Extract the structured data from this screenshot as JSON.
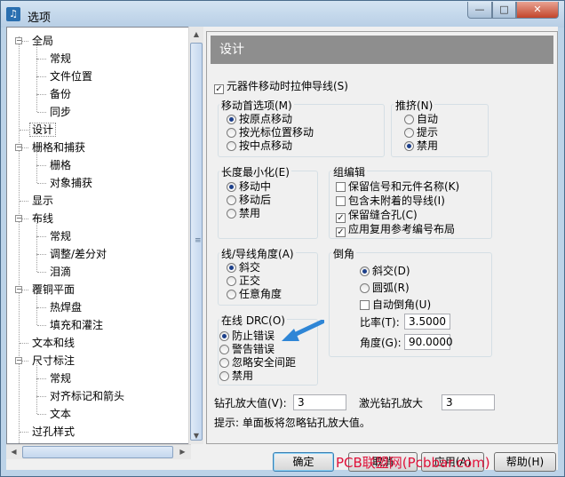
{
  "window": {
    "title": "选项",
    "app_icon": "pads-app-icon",
    "controls": {
      "minimize": "—",
      "maximize": "□",
      "close": "✕"
    }
  },
  "tree": {
    "items": [
      {
        "label": "全局",
        "level": 0,
        "expander": "−"
      },
      {
        "label": "常规",
        "level": 1
      },
      {
        "label": "文件位置",
        "level": 1
      },
      {
        "label": "备份",
        "level": 1
      },
      {
        "label": "同步",
        "level": 1
      },
      {
        "label": "设计",
        "level": 0,
        "selected": true
      },
      {
        "label": "栅格和捕获",
        "level": 0,
        "expander": "−"
      },
      {
        "label": "栅格",
        "level": 1
      },
      {
        "label": "对象捕获",
        "level": 1
      },
      {
        "label": "显示",
        "level": 0
      },
      {
        "label": "布线",
        "level": 0,
        "expander": "−"
      },
      {
        "label": "常规",
        "level": 1
      },
      {
        "label": "调整/差分对",
        "level": 1
      },
      {
        "label": "泪滴",
        "level": 1
      },
      {
        "label": "覆铜平面",
        "level": 0,
        "expander": "−"
      },
      {
        "label": "热焊盘",
        "level": 1
      },
      {
        "label": "填充和灌注",
        "level": 1
      },
      {
        "label": "文本和线",
        "level": 0
      },
      {
        "label": "尺寸标注",
        "level": 0,
        "expander": "−"
      },
      {
        "label": "常规",
        "level": 1
      },
      {
        "label": "对齐标记和箭头",
        "level": 1
      },
      {
        "label": "文本",
        "level": 1
      },
      {
        "label": "过孔样式",
        "level": 0
      }
    ]
  },
  "panel": {
    "title": "设计",
    "stretch_traces": {
      "label": "元器件移动时拉伸导线(S)",
      "checked": true
    },
    "move_pref": {
      "title": "移动首选项(M)",
      "options": [
        "按原点移动",
        "按光标位置移动",
        "按中点移动"
      ],
      "selected": 0
    },
    "push": {
      "title": "推挤(N)",
      "options": [
        "自动",
        "提示",
        "禁用"
      ],
      "selected": 2
    },
    "length_min": {
      "title": "长度最小化(E)",
      "options": [
        "移动中",
        "移动后",
        "禁用"
      ],
      "selected": 0
    },
    "group_edit": {
      "title": "组编辑",
      "checks": [
        {
          "label": "保留信号和元件名称(K)",
          "checked": false
        },
        {
          "label": "包含未附着的导线(I)",
          "checked": false
        },
        {
          "label": "保留缝合孔(C)",
          "checked": true
        },
        {
          "label": "应用复用参考编号布局",
          "checked": true
        }
      ]
    },
    "line_angle": {
      "title": "线/导线角度(A)",
      "options": [
        "斜交",
        "正交",
        "任意角度"
      ],
      "selected": 0
    },
    "chamfer": {
      "title": "倒角",
      "options": [
        "斜交(D)",
        "圆弧(R)"
      ],
      "selected": 0,
      "auto": {
        "label": "自动倒角(U)",
        "checked": false
      },
      "ratio_label": "比率(T):",
      "ratio_value": "3.5000",
      "angle_label": "角度(G):",
      "angle_value": "90.0000"
    },
    "drc": {
      "title": "在线 DRC(O)",
      "options": [
        "防止错误",
        "警告错误",
        "忽略安全间距",
        "禁用"
      ],
      "selected": 0
    },
    "drill_oversize": {
      "label": "钻孔放大值(V):",
      "value": "3"
    },
    "laser_oversize": {
      "label": "激光钻孔放大",
      "value": "3"
    },
    "hint": "提示: 单面板将忽略钻孔放大值。",
    "arrow_color": "#2f86d6"
  },
  "buttons": {
    "ok": "确定",
    "cancel": "取消",
    "apply": "应用(A)",
    "help": "帮助(H)"
  },
  "watermark": "PCB联盟网(Pcbbar.com)"
}
